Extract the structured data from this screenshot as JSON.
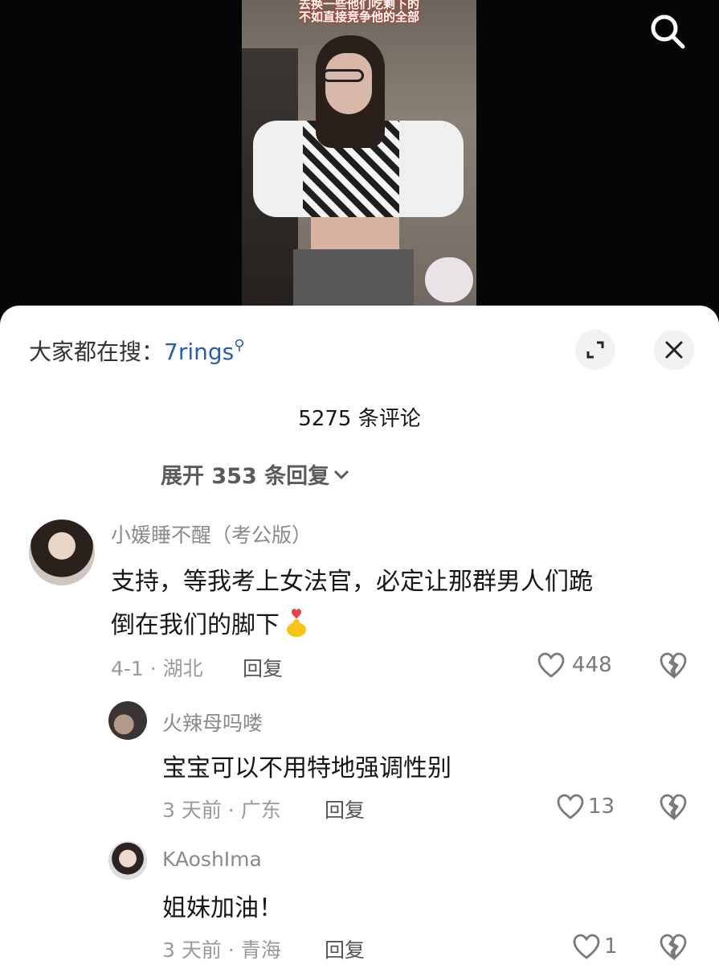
{
  "video": {
    "caption_line1": "去换一些他们吃剩下的",
    "caption_line2": "不如直接竞争他的全部",
    "search_icon": "search-icon"
  },
  "sheet": {
    "hot_search_prefix": "大家都在搜：",
    "hot_search_keyword": "7rings",
    "comment_count": "5275 条评论",
    "expand_replies": "展开 353 条回复",
    "icons": {
      "expand": "expand-icon",
      "close": "close-icon"
    }
  },
  "comments": [
    {
      "user": "小媛睡不醒（考公版）",
      "text_line1": "支持，等我考上女法官，必定让那群男人们跪",
      "text_line2": "倒在我们的脚下",
      "emoji": "finger-heart-emoji",
      "meta": "4-1 · 湖北",
      "reply": "回复",
      "likes": "448"
    },
    {
      "user": "火辣母吗喽",
      "text": "宝宝可以不用特地强调性别",
      "meta": "3 天前 · 广东",
      "reply": "回复",
      "likes": "13"
    },
    {
      "user": "KAoshIma",
      "text": "姐妹加油！",
      "meta": "3 天前 · 青海",
      "reply": "回复",
      "likes": "1"
    }
  ],
  "colors": {
    "keyword": "#2b5ea8",
    "caption_glow": "#c5392b",
    "emoji_heart": "#e8424a",
    "emoji_hand": "#f5c518"
  }
}
